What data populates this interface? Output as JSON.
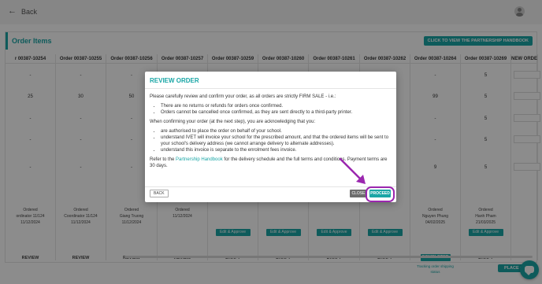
{
  "header": {
    "back_label": "Back",
    "back_icon": "arrow-left-icon",
    "avatar_icon": "user-avatar-icon"
  },
  "panel": {
    "title": "Order Items",
    "handbook_button": "CLICK TO VIEW THE PARTNERSHIP HANDBOOK"
  },
  "columns": [
    {
      "header": "r 00387-10254",
      "values": [
        "-",
        "25",
        "-",
        "-",
        "-"
      ],
      "status": [
        "Ordered",
        "ordinator 11/124",
        "11/12/2024"
      ],
      "edit": false,
      "state": "REVIEW",
      "new_state": false
    },
    {
      "header": "Order 00387-10255",
      "values": [
        "-",
        "30",
        "-",
        "-",
        "-"
      ],
      "status": [
        "Ordered",
        "Coordinator 11/124",
        "11/12/2024"
      ],
      "edit": false,
      "state": "REVIEW",
      "new_state": false
    },
    {
      "header": "Order 00387-10256",
      "values": [
        "-",
        "50",
        "-",
        "-",
        "-"
      ],
      "status": [
        "Ordered",
        "Giang Truong",
        "11/12/2024"
      ],
      "edit": false,
      "state": "REVIEW",
      "new_state": false
    },
    {
      "header": "Order 00387-10257",
      "values": [
        "-",
        "",
        "-",
        "-",
        "-"
      ],
      "status": [
        "Ordered",
        "",
        "11/12/2024"
      ],
      "edit": false,
      "state": "REVIEW",
      "new_state": false
    },
    {
      "header": "Order 00387-10259",
      "values": [
        "-",
        "",
        "-",
        "-",
        "-"
      ],
      "status": [],
      "edit": true,
      "state": "DRAFT",
      "new_state": false
    },
    {
      "header": "Order 00387-10260",
      "values": [
        "-",
        "",
        "-",
        "-",
        "-"
      ],
      "status": [],
      "edit": true,
      "state": "DRAFT",
      "new_state": false
    },
    {
      "header": "Order 00387-10261",
      "values": [
        "-",
        "",
        "-",
        "-",
        "-"
      ],
      "status": [],
      "edit": true,
      "state": "DRAFT",
      "new_state": false
    },
    {
      "header": "Order 00387-10262",
      "values": [
        "-",
        "",
        "-",
        "-",
        "-"
      ],
      "status": [],
      "edit": true,
      "state": "DRAFT",
      "new_state": false
    },
    {
      "header": "Order 00387-10264",
      "values": [
        "-",
        "99",
        "-",
        "-",
        "9"
      ],
      "status": [
        "Ordered",
        "Nguyen Phung",
        "04/02/2025"
      ],
      "edit": false,
      "state": "COMPLETED",
      "new_state": true
    },
    {
      "header": "Order 00387-10269",
      "values": [
        "5",
        "5",
        "5",
        "5",
        "5"
      ],
      "status": [
        "Ordered",
        "Hanh Pham",
        "21/03/2025"
      ],
      "edit": true,
      "state": "DRAFT",
      "new_state": false
    },
    {
      "header": "NEW ORDER",
      "values": [],
      "status": [],
      "edit": false,
      "state": "",
      "new_state": false
    }
  ],
  "edit_label": "Edit & Approve",
  "tracking_text": [
    "Tracking order shipping",
    "status"
  ],
  "place_order_label": "PLACE OR",
  "modal": {
    "title": "REVIEW ORDER",
    "intro": "Please carefully review and confirm your order, as all orders are strictly FIRM SALE - i.e.:",
    "bullets1": [
      "There are no returns or refunds for orders once confirmed.",
      "Orders cannot be cancelled once confirmed, as they are sent directly to a third-party printer."
    ],
    "ack": "When confirming your order (at the next step), you are acknowledging that you:",
    "bullets2": [
      "are authorised to place the order on behalf of your school.",
      "understand IVET will invoice your school for the prescribed amount, and that the ordered items will be sent to your school's delivery address (we cannot arrange delivery to alternate addresses).",
      "understand this invoice is separate to the enrolment fees invoice."
    ],
    "refer_prefix": "Refer to the ",
    "refer_link": "Partnership Handbook",
    "refer_suffix": " for the delivery schedule and the full terms and conditions. Payment terms are 30 days.",
    "back_button": "BACK",
    "close_button": "CLOSE",
    "proceed_button": "PROCEED"
  }
}
